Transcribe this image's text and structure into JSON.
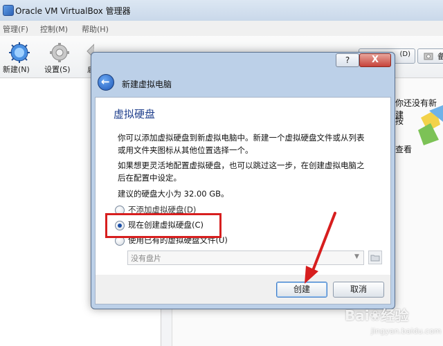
{
  "window": {
    "title": "Oracle VM VirtualBox 管理器"
  },
  "menu": [
    {
      "label": "管理(F)"
    },
    {
      "label": "控制(M)"
    },
    {
      "label": "帮助(H)"
    }
  ],
  "toolbar": {
    "new_label": "新建(N)",
    "settings_label": "设置(S)",
    "start_label_partial": "启",
    "right_btn_label": "(D)",
    "right_btn2_label": "备"
  },
  "right_pane": {
    "line1": "你还没有新建",
    "line2": "按",
    "line3": "查看"
  },
  "dialog": {
    "help_label": "?",
    "close_label": "X",
    "title": "新建虚拟电脑",
    "section_title": "虚拟硬盘",
    "para1_line1": "你可以添加虚拟硬盘到新虚拟电脑中。新建一个虚拟硬盘文件或从列表",
    "para1_line2": "或用文件夹图标从其他位置选择一个。",
    "para2_line1": "如果想更灵活地配置虚拟硬盘，也可以跳过这一步，在创建虚拟电脑之",
    "para2_line2": "后在配置中设定。",
    "recommended": "建议的硬盘大小为 32.00 GB。",
    "options": [
      {
        "label": "不添加虚拟硬盘(D)",
        "selected": false
      },
      {
        "label": "现在创建虚拟硬盘(C)",
        "selected": true
      },
      {
        "label": "使用已有的虚拟硬盘文件(U)",
        "selected": false
      }
    ],
    "disk_select_value": "没有盘片",
    "create_label": "创建",
    "cancel_label": "取消"
  },
  "watermark": {
    "logo": "Bai❀经验",
    "url": "jingyan.baidu.com"
  },
  "colors": {
    "highlight": "#d71e1e",
    "section_title": "#1e3e8c",
    "accent": "#1a4fa8"
  }
}
